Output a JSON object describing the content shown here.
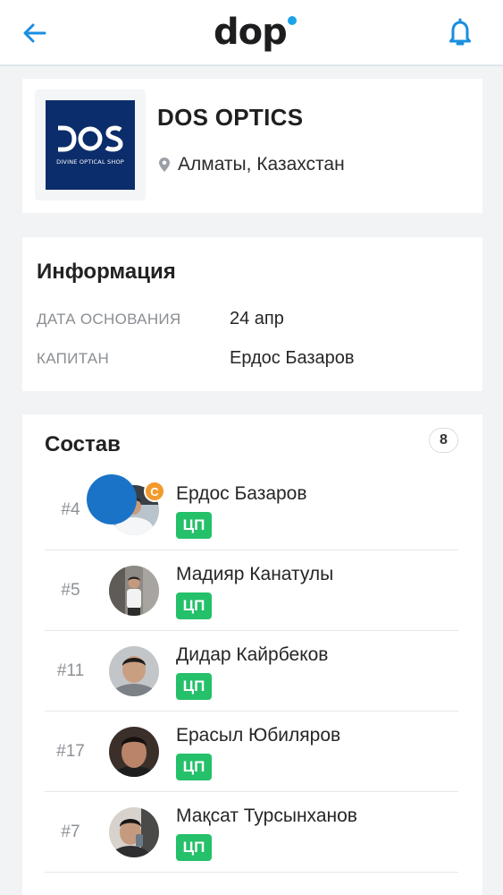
{
  "header": {
    "logo_text": "dop",
    "logo_dot_color": "#1aa3e8",
    "back_icon": "arrow-left-icon",
    "bell_icon": "bell-icon",
    "accent_color": "#1a8ee0"
  },
  "team": {
    "logo_text": "DOS",
    "logo_tagline": "DIVINE OPTICAL SHOP",
    "name": "DOS OPTICS",
    "location": "Алматы, Казахстан"
  },
  "info": {
    "title": "Информация",
    "founded_label": "ДАТА ОСНОВАНИЯ",
    "founded_value": "24 апр",
    "captain_label": "КАПИТАН",
    "captain_value": "Ердос Базаров"
  },
  "roster": {
    "title": "Состав",
    "count": "8",
    "captain_badge": "С",
    "role_color": "#25c06a",
    "members": [
      {
        "number": "#4",
        "name": "Ердос Базаров",
        "role": "ЦП"
      },
      {
        "number": "#5",
        "name": "Мадияр Канатулы",
        "role": "ЦП"
      },
      {
        "number": "#11",
        "name": "Дидар Кайрбеков",
        "role": "ЦП"
      },
      {
        "number": "#17",
        "name": "Ерасыл Юбиляров",
        "role": "ЦП"
      },
      {
        "number": "#7",
        "name": "Мақсат Турсынханов",
        "role": "ЦП"
      }
    ]
  }
}
